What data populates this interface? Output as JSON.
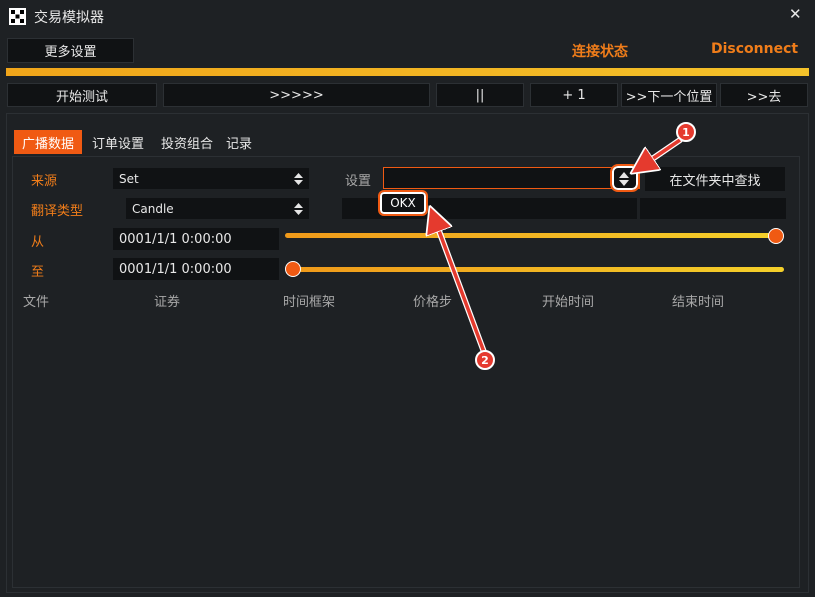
{
  "window": {
    "title": "交易模拟器",
    "close_symbol": "✕"
  },
  "toolbar": {
    "more_settings": "更多设置",
    "status_label": "连接状态",
    "disconnect": "Disconnect"
  },
  "controls": {
    "start_test": "开始测试",
    "fast_forward": ">>>>>",
    "pause": "||",
    "plus_one": "+ 1",
    "next_position": ">>下一个位置",
    "go_to": ">>去"
  },
  "tabs": [
    {
      "label": "广播数据",
      "active": true
    },
    {
      "label": "订单设置",
      "active": false
    },
    {
      "label": "投资组合",
      "active": false
    },
    {
      "label": "记录",
      "active": false
    }
  ],
  "form": {
    "source_label": "来源",
    "source_value": "Set",
    "translation_label": "翻译类型",
    "translation_value": "Candle",
    "from_label": "从",
    "from_value": "0001/1/1 0:00:00",
    "to_label": "至",
    "to_value": "0001/1/1 0:00:00",
    "settings_label": "设置",
    "settings_value": "",
    "find_in_folder": "在文件夹中查找",
    "dropdown_option": "OKX"
  },
  "sliders": {
    "from_position": 1.0,
    "to_position": 0.0
  },
  "table": {
    "columns": [
      "文件",
      "证券",
      "时间框架",
      "价格步",
      "开始时间",
      "结束时间"
    ]
  },
  "annotations": {
    "callout_1": "1",
    "callout_2": "2"
  },
  "colors": {
    "accent": "#f05a13",
    "status": "#f07d1a",
    "progress": "#f4c22a",
    "annotation": "#e53a2e"
  }
}
